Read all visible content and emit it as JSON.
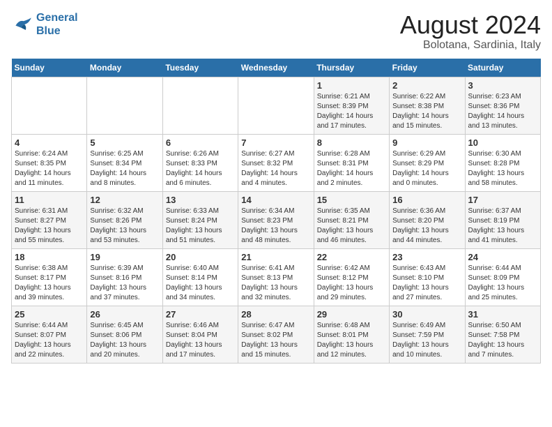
{
  "logo": {
    "line1": "General",
    "line2": "Blue"
  },
  "title": "August 2024",
  "subtitle": "Bolotana, Sardinia, Italy",
  "weekdays": [
    "Sunday",
    "Monday",
    "Tuesday",
    "Wednesday",
    "Thursday",
    "Friday",
    "Saturday"
  ],
  "weeks": [
    [
      {
        "day": "",
        "info": ""
      },
      {
        "day": "",
        "info": ""
      },
      {
        "day": "",
        "info": ""
      },
      {
        "day": "",
        "info": ""
      },
      {
        "day": "1",
        "info": "Sunrise: 6:21 AM\nSunset: 8:39 PM\nDaylight: 14 hours and 17 minutes."
      },
      {
        "day": "2",
        "info": "Sunrise: 6:22 AM\nSunset: 8:38 PM\nDaylight: 14 hours and 15 minutes."
      },
      {
        "day": "3",
        "info": "Sunrise: 6:23 AM\nSunset: 8:36 PM\nDaylight: 14 hours and 13 minutes."
      }
    ],
    [
      {
        "day": "4",
        "info": "Sunrise: 6:24 AM\nSunset: 8:35 PM\nDaylight: 14 hours and 11 minutes."
      },
      {
        "day": "5",
        "info": "Sunrise: 6:25 AM\nSunset: 8:34 PM\nDaylight: 14 hours and 8 minutes."
      },
      {
        "day": "6",
        "info": "Sunrise: 6:26 AM\nSunset: 8:33 PM\nDaylight: 14 hours and 6 minutes."
      },
      {
        "day": "7",
        "info": "Sunrise: 6:27 AM\nSunset: 8:32 PM\nDaylight: 14 hours and 4 minutes."
      },
      {
        "day": "8",
        "info": "Sunrise: 6:28 AM\nSunset: 8:31 PM\nDaylight: 14 hours and 2 minutes."
      },
      {
        "day": "9",
        "info": "Sunrise: 6:29 AM\nSunset: 8:29 PM\nDaylight: 14 hours and 0 minutes."
      },
      {
        "day": "10",
        "info": "Sunrise: 6:30 AM\nSunset: 8:28 PM\nDaylight: 13 hours and 58 minutes."
      }
    ],
    [
      {
        "day": "11",
        "info": "Sunrise: 6:31 AM\nSunset: 8:27 PM\nDaylight: 13 hours and 55 minutes."
      },
      {
        "day": "12",
        "info": "Sunrise: 6:32 AM\nSunset: 8:26 PM\nDaylight: 13 hours and 53 minutes."
      },
      {
        "day": "13",
        "info": "Sunrise: 6:33 AM\nSunset: 8:24 PM\nDaylight: 13 hours and 51 minutes."
      },
      {
        "day": "14",
        "info": "Sunrise: 6:34 AM\nSunset: 8:23 PM\nDaylight: 13 hours and 48 minutes."
      },
      {
        "day": "15",
        "info": "Sunrise: 6:35 AM\nSunset: 8:21 PM\nDaylight: 13 hours and 46 minutes."
      },
      {
        "day": "16",
        "info": "Sunrise: 6:36 AM\nSunset: 8:20 PM\nDaylight: 13 hours and 44 minutes."
      },
      {
        "day": "17",
        "info": "Sunrise: 6:37 AM\nSunset: 8:19 PM\nDaylight: 13 hours and 41 minutes."
      }
    ],
    [
      {
        "day": "18",
        "info": "Sunrise: 6:38 AM\nSunset: 8:17 PM\nDaylight: 13 hours and 39 minutes."
      },
      {
        "day": "19",
        "info": "Sunrise: 6:39 AM\nSunset: 8:16 PM\nDaylight: 13 hours and 37 minutes."
      },
      {
        "day": "20",
        "info": "Sunrise: 6:40 AM\nSunset: 8:14 PM\nDaylight: 13 hours and 34 minutes."
      },
      {
        "day": "21",
        "info": "Sunrise: 6:41 AM\nSunset: 8:13 PM\nDaylight: 13 hours and 32 minutes."
      },
      {
        "day": "22",
        "info": "Sunrise: 6:42 AM\nSunset: 8:12 PM\nDaylight: 13 hours and 29 minutes."
      },
      {
        "day": "23",
        "info": "Sunrise: 6:43 AM\nSunset: 8:10 PM\nDaylight: 13 hours and 27 minutes."
      },
      {
        "day": "24",
        "info": "Sunrise: 6:44 AM\nSunset: 8:09 PM\nDaylight: 13 hours and 25 minutes."
      }
    ],
    [
      {
        "day": "25",
        "info": "Sunrise: 6:44 AM\nSunset: 8:07 PM\nDaylight: 13 hours and 22 minutes."
      },
      {
        "day": "26",
        "info": "Sunrise: 6:45 AM\nSunset: 8:06 PM\nDaylight: 13 hours and 20 minutes."
      },
      {
        "day": "27",
        "info": "Sunrise: 6:46 AM\nSunset: 8:04 PM\nDaylight: 13 hours and 17 minutes."
      },
      {
        "day": "28",
        "info": "Sunrise: 6:47 AM\nSunset: 8:02 PM\nDaylight: 13 hours and 15 minutes."
      },
      {
        "day": "29",
        "info": "Sunrise: 6:48 AM\nSunset: 8:01 PM\nDaylight: 13 hours and 12 minutes."
      },
      {
        "day": "30",
        "info": "Sunrise: 6:49 AM\nSunset: 7:59 PM\nDaylight: 13 hours and 10 minutes."
      },
      {
        "day": "31",
        "info": "Sunrise: 6:50 AM\nSunset: 7:58 PM\nDaylight: 13 hours and 7 minutes."
      }
    ]
  ]
}
